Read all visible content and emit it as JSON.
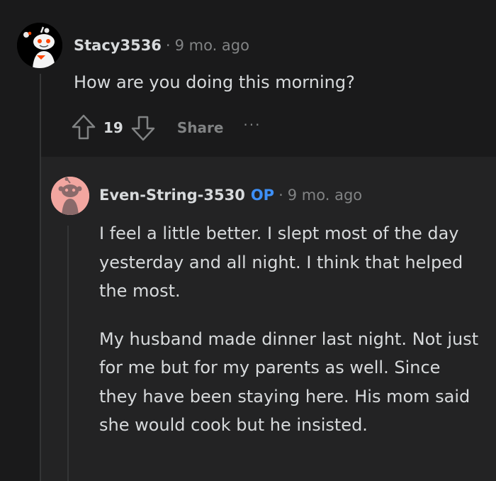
{
  "comment": {
    "username": "Stacy3536",
    "separator": "·",
    "time": "9 mo. ago",
    "body": "How are you doing this morning?",
    "votes": "19",
    "share_label": "Share",
    "more_label": "···"
  },
  "reply": {
    "username": "Even-String-3530",
    "op_badge": "OP",
    "separator": "·",
    "time": "9 mo. ago",
    "paragraphs": [
      "I feel a little better. I slept most of the day yesterday and all night. I think that helped the most.",
      "My husband made dinner last night. Not just for me but for my parents as well. Since they have been staying here. His mom said she would cook but he insisted."
    ]
  },
  "colors": {
    "background": "#1a1a1b",
    "reply_background": "#232324",
    "op_badge": "#3d8ff6",
    "avatar_reply": "#f2a6a0",
    "snoo_accent": "#ff4500"
  },
  "icons": {
    "avatar_1": "snoo-avatar-icon",
    "avatar_2": "snoo-avatar-icon",
    "upvote": "upvote-arrow-icon",
    "downvote": "downvote-arrow-icon"
  }
}
